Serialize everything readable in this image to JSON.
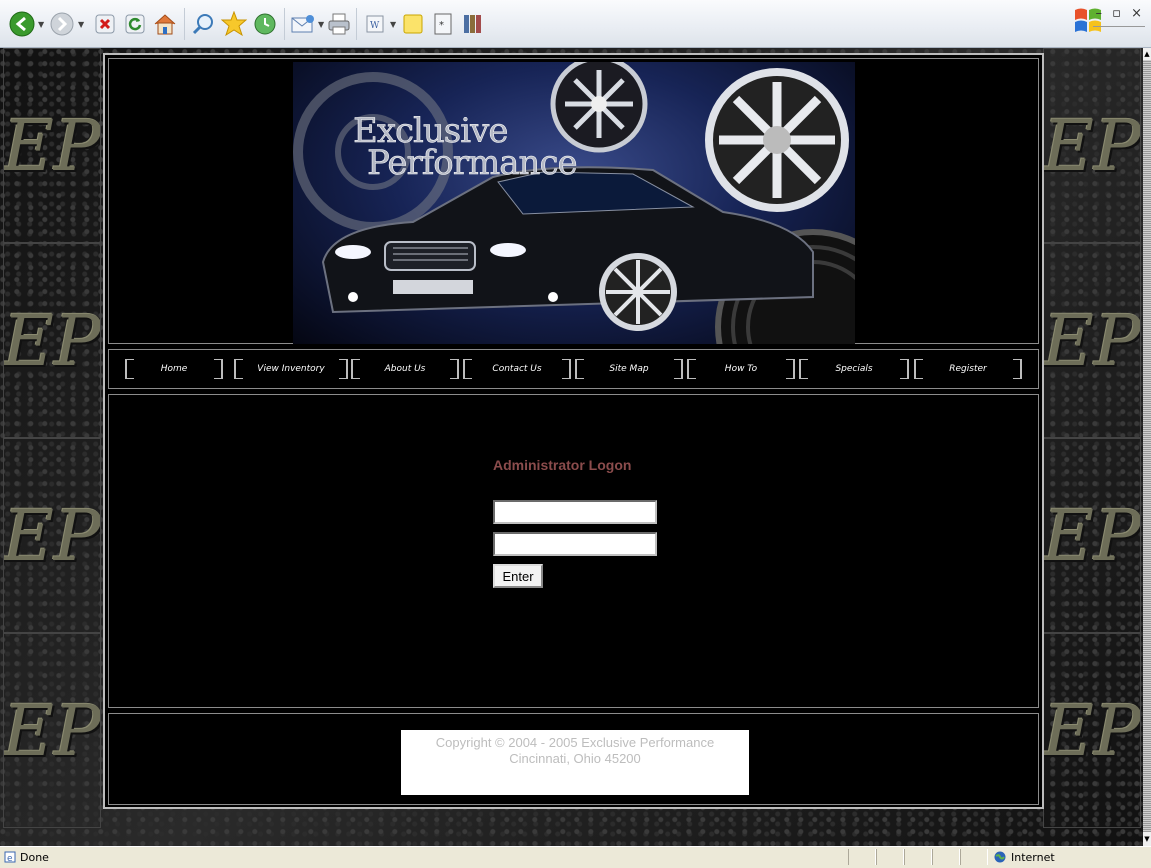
{
  "toolbar": {
    "buttons": [
      "back-icon",
      "forward-icon",
      "stop-icon",
      "refresh-icon",
      "home-icon",
      "search-icon",
      "favorites-icon",
      "history-icon",
      "mail-icon",
      "print-icon",
      "edit-icon",
      "notes-icon",
      "research-icon",
      "messenger-icon"
    ],
    "window_controls": "– ▫ ×"
  },
  "banner": {
    "logo_line1": "Exclusive",
    "logo_line2": "Performance"
  },
  "nav": {
    "items": [
      {
        "label": "Home"
      },
      {
        "label": "View Inventory"
      },
      {
        "label": "About Us"
      },
      {
        "label": "Contact Us"
      },
      {
        "label": "Site Map"
      },
      {
        "label": "How To"
      },
      {
        "label": "Specials"
      },
      {
        "label": "Register"
      }
    ]
  },
  "background": {
    "tile_text": "EP"
  },
  "logon": {
    "title": "Administrator Logon",
    "username_value": "",
    "password_value": "",
    "button_label": "Enter"
  },
  "footer": {
    "copyright_line1": "Copyright © 2004 - 2005 Exclusive Performance",
    "copyright_line2": "Cincinnati, Ohio 45200"
  },
  "statusbar": {
    "status": "Done",
    "zone": "Internet"
  }
}
